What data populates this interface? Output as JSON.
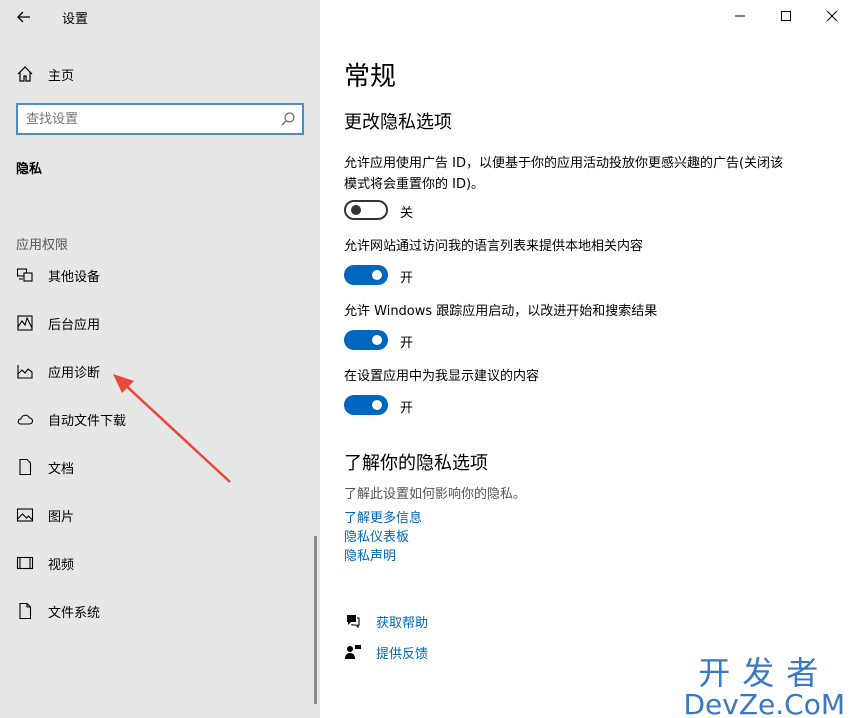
{
  "window": {
    "title": "设置",
    "controls": {
      "minimize": "minimize",
      "maximize": "maximize",
      "close": "close"
    }
  },
  "sidebar": {
    "home_label": "主页",
    "search_placeholder": "查找设置",
    "current_section": "隐私",
    "group_header": "应用权限",
    "items": [
      {
        "label": "其他设备",
        "icon": "devices-icon"
      },
      {
        "label": "后台应用",
        "icon": "background-apps-icon"
      },
      {
        "label": "应用诊断",
        "icon": "app-diagnostics-icon"
      },
      {
        "label": "自动文件下载",
        "icon": "cloud-icon"
      },
      {
        "label": "文档",
        "icon": "document-icon"
      },
      {
        "label": "图片",
        "icon": "picture-icon"
      },
      {
        "label": "视频",
        "icon": "video-icon"
      },
      {
        "label": "文件系统",
        "icon": "file-system-icon"
      }
    ]
  },
  "main": {
    "title": "常规",
    "privacy_section_title": "更改隐私选项",
    "options": [
      {
        "text": "允许应用使用广告 ID，以便基于你的应用活动投放你更感兴趣的广告(关闭该模式将会重置你的 ID)。",
        "state": "关",
        "on": false
      },
      {
        "text": "允许网站通过访问我的语言列表来提供本地相关内容",
        "state": "开",
        "on": true
      },
      {
        "text": "允许 Windows 跟踪应用启动，以改进开始和搜索结果",
        "state": "开",
        "on": true
      },
      {
        "text": "在设置应用中为我显示建议的内容",
        "state": "开",
        "on": true
      }
    ],
    "learn_section_title": "了解你的隐私选项",
    "learn_desc": "了解此设置如何影响你的隐私。",
    "links": [
      "了解更多信息",
      "隐私仪表板",
      "隐私声明"
    ],
    "help": {
      "get_help": "获取帮助",
      "feedback": "提供反馈"
    }
  },
  "watermark": {
    "line1": "开发者",
    "line2": "DevZe.CoM"
  },
  "colors": {
    "accent": "#0067c0",
    "link": "#0067b8",
    "sidebar_bg": "#e6e6e6",
    "arrow": "#e8483a"
  }
}
